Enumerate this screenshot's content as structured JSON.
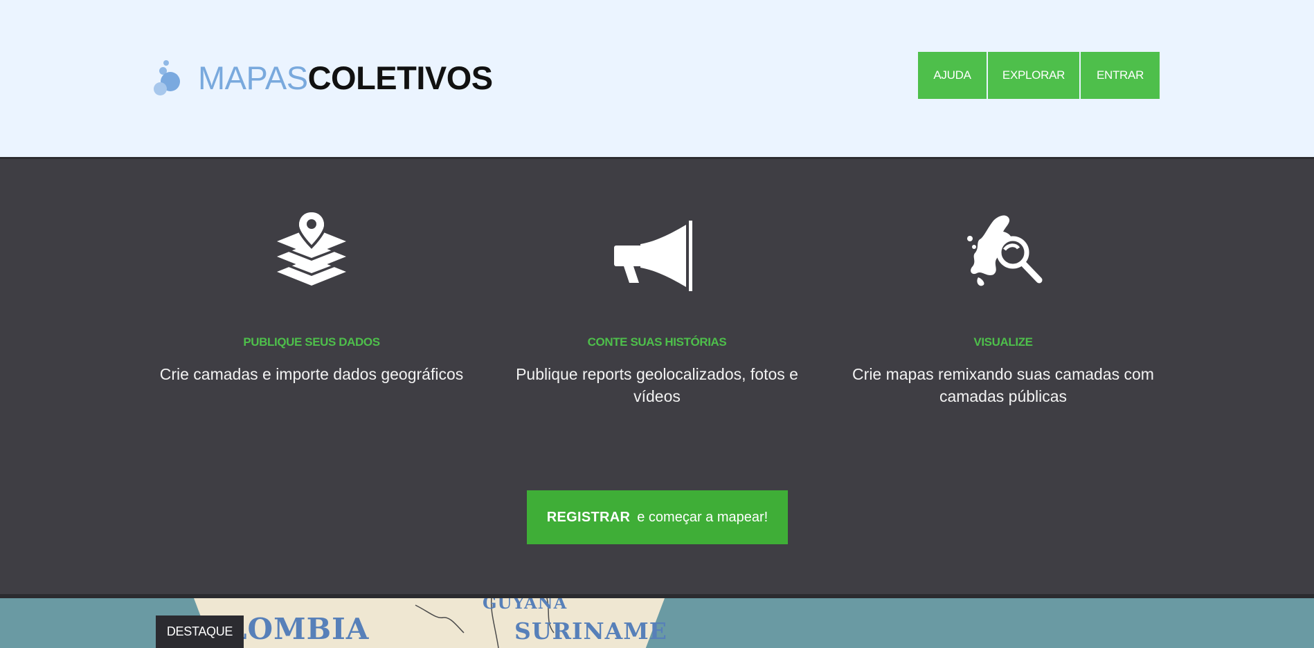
{
  "header": {
    "logo_light": "MAPAS",
    "logo_bold": "COLETIVOS",
    "nav": [
      {
        "label": "AJUDA"
      },
      {
        "label": "EXPLORAR"
      },
      {
        "label": "ENTRAR"
      }
    ]
  },
  "features": [
    {
      "icon": "layers-pin-icon",
      "title": "PUBLIQUE SEUS DADOS",
      "desc": "Crie camadas e importe dados geográficos"
    },
    {
      "icon": "megaphone-icon",
      "title": "CONTE SUAS HISTÓRIAS",
      "desc": "Publique reports geolocalizados, fotos e vídeos"
    },
    {
      "icon": "map-magnifier-icon",
      "title": "VISUALIZE",
      "desc": "Crie mapas remixando suas camadas com camadas públicas"
    }
  ],
  "register": {
    "bold": "REGISTRAR",
    "rest": "e começar a mapear!"
  },
  "map": {
    "labels": [
      "COLOMBIA",
      "GUYANA",
      "SURINAME"
    ]
  },
  "destaque": "DESTAQUE",
  "colors": {
    "accent": "#4ebf4b",
    "dark": "#3f3e44",
    "header_bg": "#ebf4ff"
  }
}
